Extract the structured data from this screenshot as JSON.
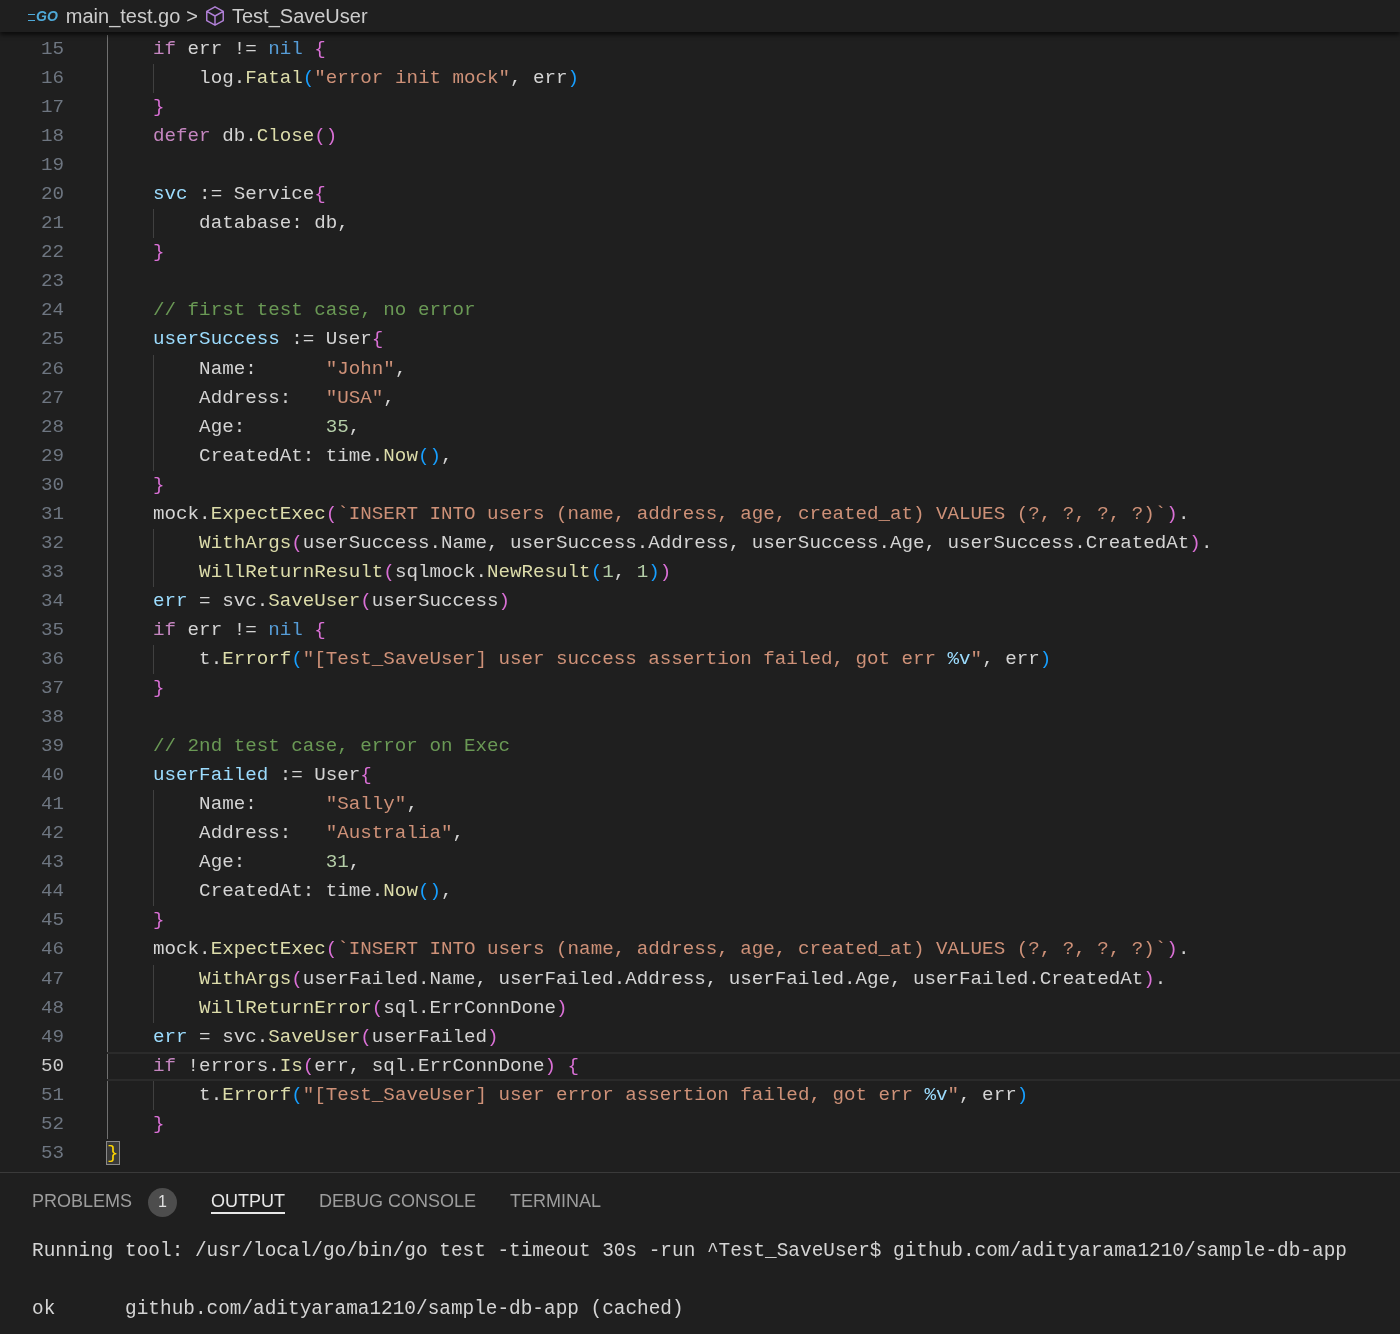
{
  "breadcrumb": {
    "file_icon_text": "GO",
    "file": "main_test.go",
    "separator": ">",
    "symbol": "Test_SaveUser"
  },
  "editor": {
    "lines": [
      {
        "n": "15",
        "current": false,
        "tokens": [
          {
            "text": "    if",
            "kind": "kw"
          },
          {
            "text": " err != ",
            "kind": "txt"
          },
          {
            "text": "nil",
            "kind": "con"
          },
          {
            "text": " {",
            "kind": "b2"
          }
        ]
      },
      {
        "n": "16",
        "current": false,
        "tokens": [
          {
            "text": "        log.",
            "kind": "txt"
          },
          {
            "text": "Fatal",
            "kind": "fn"
          },
          {
            "text": "(",
            "kind": "b3"
          },
          {
            "text": "\"error init mock\"",
            "kind": "str"
          },
          {
            "text": ", err",
            "kind": "txt"
          },
          {
            "text": ")",
            "kind": "b3"
          }
        ]
      },
      {
        "n": "17",
        "current": false,
        "tokens": [
          {
            "text": "    }",
            "kind": "b2"
          }
        ]
      },
      {
        "n": "18",
        "current": false,
        "tokens": [
          {
            "text": "    defer",
            "kind": "kw"
          },
          {
            "text": " db.",
            "kind": "txt"
          },
          {
            "text": "Close",
            "kind": "fn"
          },
          {
            "text": "()",
            "kind": "b2"
          }
        ]
      },
      {
        "n": "19",
        "current": false
      },
      {
        "n": "20",
        "current": false,
        "tokens": [
          {
            "text": "    svc",
            "kind": "var"
          },
          {
            "text": " := Service",
            "kind": "txt"
          },
          {
            "text": "{",
            "kind": "b2"
          }
        ]
      },
      {
        "n": "21",
        "current": false,
        "tokens": [
          {
            "text": "        database: db,",
            "kind": "txt"
          }
        ]
      },
      {
        "n": "22",
        "current": false,
        "tokens": [
          {
            "text": "    }",
            "kind": "b2"
          }
        ]
      },
      {
        "n": "23",
        "current": false
      },
      {
        "n": "24",
        "current": false,
        "tokens": [
          {
            "text": "    // first test case, no error",
            "kind": "com"
          }
        ]
      },
      {
        "n": "25",
        "current": false,
        "tokens": [
          {
            "text": "    userSuccess",
            "kind": "var"
          },
          {
            "text": " := User",
            "kind": "txt"
          },
          {
            "text": "{",
            "kind": "b2"
          }
        ]
      },
      {
        "n": "26",
        "current": false,
        "tokens": [
          {
            "text": "        Name:      ",
            "kind": "txt"
          },
          {
            "text": "\"John\"",
            "kind": "str"
          },
          {
            "text": ",",
            "kind": "txt"
          }
        ]
      },
      {
        "n": "27",
        "current": false,
        "tokens": [
          {
            "text": "        Address:   ",
            "kind": "txt"
          },
          {
            "text": "\"USA\"",
            "kind": "str"
          },
          {
            "text": ",",
            "kind": "txt"
          }
        ]
      },
      {
        "n": "28",
        "current": false,
        "tokens": [
          {
            "text": "        Age:       ",
            "kind": "txt"
          },
          {
            "text": "35",
            "kind": "num"
          },
          {
            "text": ",",
            "kind": "txt"
          }
        ]
      },
      {
        "n": "29",
        "current": false,
        "tokens": [
          {
            "text": "        CreatedAt: time.",
            "kind": "txt"
          },
          {
            "text": "Now",
            "kind": "fn"
          },
          {
            "text": "()",
            "kind": "b3"
          },
          {
            "text": ",",
            "kind": "txt"
          }
        ]
      },
      {
        "n": "30",
        "current": false,
        "tokens": [
          {
            "text": "    }",
            "kind": "b2"
          }
        ]
      },
      {
        "n": "31",
        "current": false,
        "tokens": [
          {
            "text": "    mock.",
            "kind": "txt"
          },
          {
            "text": "ExpectExec",
            "kind": "fn"
          },
          {
            "text": "(",
            "kind": "b2"
          },
          {
            "text": "`INSERT INTO users (name, address, age, created_at) VALUES (?, ?, ?, ?)`",
            "kind": "str"
          },
          {
            "text": ")",
            "kind": "b2"
          },
          {
            "text": ".",
            "kind": "txt"
          }
        ]
      },
      {
        "n": "32",
        "current": false,
        "tokens": [
          {
            "text": "        WithArgs",
            "kind": "fn"
          },
          {
            "text": "(",
            "kind": "b2"
          },
          {
            "text": "userSuccess.Name, userSuccess.Address, userSuccess.Age, userSuccess.CreatedAt",
            "kind": "txt"
          },
          {
            "text": ")",
            "kind": "b2"
          },
          {
            "text": ".",
            "kind": "txt"
          }
        ]
      },
      {
        "n": "33",
        "current": false,
        "tokens": [
          {
            "text": "        WillReturnResult",
            "kind": "fn"
          },
          {
            "text": "(",
            "kind": "b2"
          },
          {
            "text": "sqlmock.",
            "kind": "txt"
          },
          {
            "text": "NewResult",
            "kind": "fn"
          },
          {
            "text": "(",
            "kind": "b3"
          },
          {
            "text": "1",
            "kind": "num"
          },
          {
            "text": ", ",
            "kind": "txt"
          },
          {
            "text": "1",
            "kind": "num"
          },
          {
            "text": ")",
            "kind": "b3"
          },
          {
            "text": ")",
            "kind": "b2"
          }
        ]
      },
      {
        "n": "34",
        "current": false,
        "tokens": [
          {
            "text": "    err",
            "kind": "var"
          },
          {
            "text": " = svc.",
            "kind": "txt"
          },
          {
            "text": "SaveUser",
            "kind": "fn"
          },
          {
            "text": "(",
            "kind": "b2"
          },
          {
            "text": "userSuccess",
            "kind": "txt"
          },
          {
            "text": ")",
            "kind": "b2"
          }
        ]
      },
      {
        "n": "35",
        "current": false,
        "tokens": [
          {
            "text": "    if",
            "kind": "kw"
          },
          {
            "text": " err != ",
            "kind": "txt"
          },
          {
            "text": "nil",
            "kind": "con"
          },
          {
            "text": " {",
            "kind": "b2"
          }
        ]
      },
      {
        "n": "36",
        "current": false,
        "tokens": [
          {
            "text": "        t.",
            "kind": "txt"
          },
          {
            "text": "Errorf",
            "kind": "fn"
          },
          {
            "text": "(",
            "kind": "b3"
          },
          {
            "text": "\"[Test_SaveUser] user success assertion failed, got err ",
            "kind": "str"
          },
          {
            "text": "%v",
            "kind": "esc"
          },
          {
            "text": "\"",
            "kind": "str"
          },
          {
            "text": ", err",
            "kind": "txt"
          },
          {
            "text": ")",
            "kind": "b3"
          }
        ]
      },
      {
        "n": "37",
        "current": false,
        "tokens": [
          {
            "text": "    }",
            "kind": "b2"
          }
        ]
      },
      {
        "n": "38",
        "current": false
      },
      {
        "n": "39",
        "current": false,
        "tokens": [
          {
            "text": "    // 2nd test case, error on Exec",
            "kind": "com"
          }
        ]
      },
      {
        "n": "40",
        "current": false,
        "tokens": [
          {
            "text": "    userFailed",
            "kind": "var"
          },
          {
            "text": " := User",
            "kind": "txt"
          },
          {
            "text": "{",
            "kind": "b2"
          }
        ]
      },
      {
        "n": "41",
        "current": false,
        "tokens": [
          {
            "text": "        Name:      ",
            "kind": "txt"
          },
          {
            "text": "\"Sally\"",
            "kind": "str"
          },
          {
            "text": ",",
            "kind": "txt"
          }
        ]
      },
      {
        "n": "42",
        "current": false,
        "tokens": [
          {
            "text": "        Address:   ",
            "kind": "txt"
          },
          {
            "text": "\"Australia\"",
            "kind": "str"
          },
          {
            "text": ",",
            "kind": "txt"
          }
        ]
      },
      {
        "n": "43",
        "current": false,
        "tokens": [
          {
            "text": "        Age:       ",
            "kind": "txt"
          },
          {
            "text": "31",
            "kind": "num"
          },
          {
            "text": ",",
            "kind": "txt"
          }
        ]
      },
      {
        "n": "44",
        "current": false,
        "tokens": [
          {
            "text": "        CreatedAt: time.",
            "kind": "txt"
          },
          {
            "text": "Now",
            "kind": "fn"
          },
          {
            "text": "()",
            "kind": "b3"
          },
          {
            "text": ",",
            "kind": "txt"
          }
        ]
      },
      {
        "n": "45",
        "current": false,
        "tokens": [
          {
            "text": "    }",
            "kind": "b2"
          }
        ]
      },
      {
        "n": "46",
        "current": false,
        "tokens": [
          {
            "text": "    mock.",
            "kind": "txt"
          },
          {
            "text": "ExpectExec",
            "kind": "fn"
          },
          {
            "text": "(",
            "kind": "b2"
          },
          {
            "text": "`INSERT INTO users (name, address, age, created_at) VALUES (?, ?, ?, ?)`",
            "kind": "str"
          },
          {
            "text": ")",
            "kind": "b2"
          },
          {
            "text": ".",
            "kind": "txt"
          }
        ]
      },
      {
        "n": "47",
        "current": false,
        "tokens": [
          {
            "text": "        WithArgs",
            "kind": "fn"
          },
          {
            "text": "(",
            "kind": "b2"
          },
          {
            "text": "userFailed.Name, userFailed.Address, userFailed.Age, userFailed.CreatedAt",
            "kind": "txt"
          },
          {
            "text": ")",
            "kind": "b2"
          },
          {
            "text": ".",
            "kind": "txt"
          }
        ]
      },
      {
        "n": "48",
        "current": false,
        "tokens": [
          {
            "text": "        WillReturnError",
            "kind": "fn"
          },
          {
            "text": "(",
            "kind": "b2"
          },
          {
            "text": "sql.ErrConnDone",
            "kind": "txt"
          },
          {
            "text": ")",
            "kind": "b2"
          }
        ]
      },
      {
        "n": "49",
        "current": false,
        "tokens": [
          {
            "text": "    err",
            "kind": "var"
          },
          {
            "text": " = svc.",
            "kind": "txt"
          },
          {
            "text": "SaveUser",
            "kind": "fn"
          },
          {
            "text": "(",
            "kind": "b2"
          },
          {
            "text": "userFailed",
            "kind": "txt"
          },
          {
            "text": ")",
            "kind": "b2"
          }
        ]
      },
      {
        "n": "50",
        "current": true,
        "tokens": [
          {
            "text": "    if",
            "kind": "kw"
          },
          {
            "text": " !errors.",
            "kind": "txt"
          },
          {
            "text": "Is",
            "kind": "fn"
          },
          {
            "text": "(",
            "kind": "b2"
          },
          {
            "text": "err, sql.ErrConnDone",
            "kind": "txt"
          },
          {
            "text": ")",
            "kind": "b2"
          },
          {
            "text": " {",
            "kind": "b2"
          }
        ]
      },
      {
        "n": "51",
        "current": false,
        "tokens": [
          {
            "text": "        t.",
            "kind": "txt"
          },
          {
            "text": "Errorf",
            "kind": "fn"
          },
          {
            "text": "(",
            "kind": "b3"
          },
          {
            "text": "\"[Test_SaveUser] user error assertion failed, got err ",
            "kind": "str"
          },
          {
            "text": "%v",
            "kind": "esc"
          },
          {
            "text": "\"",
            "kind": "str"
          },
          {
            "text": ", err",
            "kind": "txt"
          },
          {
            "text": ")",
            "kind": "b3"
          }
        ]
      },
      {
        "n": "52",
        "current": false,
        "tokens": [
          {
            "text": "    }",
            "kind": "b2"
          }
        ]
      },
      {
        "n": "53",
        "current": false,
        "tokens": [
          {
            "text": "}",
            "kind": "b1m"
          }
        ]
      }
    ]
  },
  "panel": {
    "tabs": [
      {
        "label": "PROBLEMS",
        "badge": "1",
        "selected": false
      },
      {
        "label": "OUTPUT",
        "selected": true
      },
      {
        "label": "DEBUG CONSOLE",
        "selected": false
      },
      {
        "label": "TERMINAL",
        "selected": false
      }
    ],
    "output": [
      "Running tool: /usr/local/go/bin/go test -timeout 30s -run ^Test_SaveUser$ github.com/adityarama1210/sample-db-app",
      "ok      github.com/adityarama1210/sample-db-app (cached)"
    ]
  }
}
